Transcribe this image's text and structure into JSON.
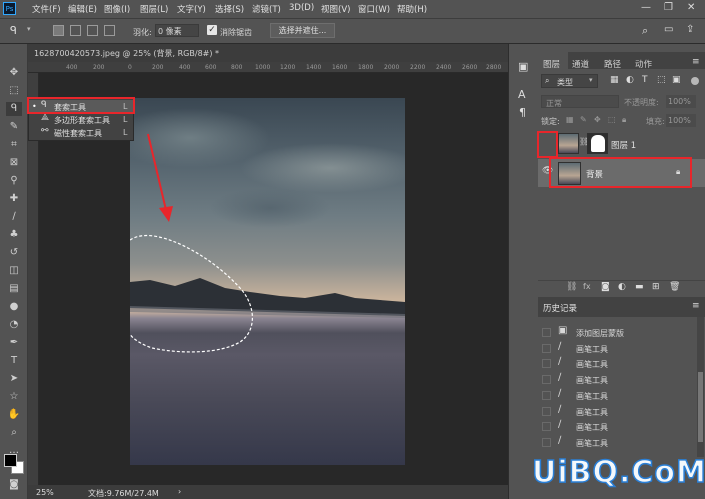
{
  "menubar": {
    "app_icon": "Ps",
    "items": [
      "文件(F)",
      "编辑(E)",
      "图像(I)",
      "图层(L)",
      "文字(Y)",
      "选择(S)",
      "滤镜(T)",
      "3D(D)",
      "视图(V)",
      "窗口(W)",
      "帮助(H)"
    ]
  },
  "options": {
    "feather_label": "羽化:",
    "feather_value": "0 像素",
    "antialias_label": "消除锯齿",
    "select_mask_button": "选择并遮住..."
  },
  "document": {
    "tab_title": "1628700420573.jpeg @ 25% (背景, RGB/8#) *",
    "ruler_labels": [
      "400",
      "200",
      "0",
      "200",
      "400",
      "600",
      "800",
      "1000",
      "1200",
      "1400",
      "1600",
      "1800",
      "2000",
      "2200",
      "2400",
      "2600",
      "2800"
    ],
    "zoom": "25%",
    "doc_info": "文档:9.76M/27.4M"
  },
  "tool_flyout": {
    "items": [
      {
        "label": "套索工具",
        "key": "L",
        "selected": true
      },
      {
        "label": "多边形套索工具",
        "key": "L",
        "selected": false
      },
      {
        "label": "磁性套索工具",
        "key": "L",
        "selected": false
      }
    ]
  },
  "layers_panel": {
    "tabs": [
      "图层",
      "通道",
      "路径",
      "动作"
    ],
    "filter_kind": "类型",
    "blend_mode": "正常",
    "opacity_label": "不透明度:",
    "opacity_value": "100%",
    "lock_label": "锁定:",
    "fill_label": "填充:",
    "fill_value": "100%",
    "layers": [
      {
        "name": "图层 1",
        "visible": false,
        "has_mask": true
      },
      {
        "name": "背景",
        "visible": true,
        "locked": true
      }
    ]
  },
  "history_panel": {
    "title": "历史记录",
    "items": [
      "添加图层蒙版",
      "画笔工具",
      "画笔工具",
      "画笔工具",
      "画笔工具",
      "画笔工具",
      "画笔工具",
      "画笔工具"
    ]
  },
  "watermark": "UiBQ.CoM",
  "colors": {
    "highlight": "#e8262b",
    "ui_gray": "#535353",
    "canvas": "#282828",
    "selected_layer": "#6b6b6b"
  }
}
